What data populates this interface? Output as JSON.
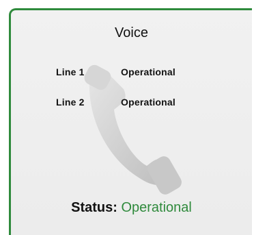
{
  "card": {
    "title": "Voice",
    "icon": "phone-handset-icon",
    "lines": [
      {
        "label": "Line 1",
        "status": "Operational"
      },
      {
        "label": "Line 2",
        "status": "Operational"
      }
    ],
    "status_label": "Status:",
    "status_value": "Operational"
  },
  "colors": {
    "accent": "#2f8a3c",
    "status_ok": "#2f8a3c",
    "panel_bg": "#ececec",
    "icon_fill": "#cfcfcf"
  }
}
